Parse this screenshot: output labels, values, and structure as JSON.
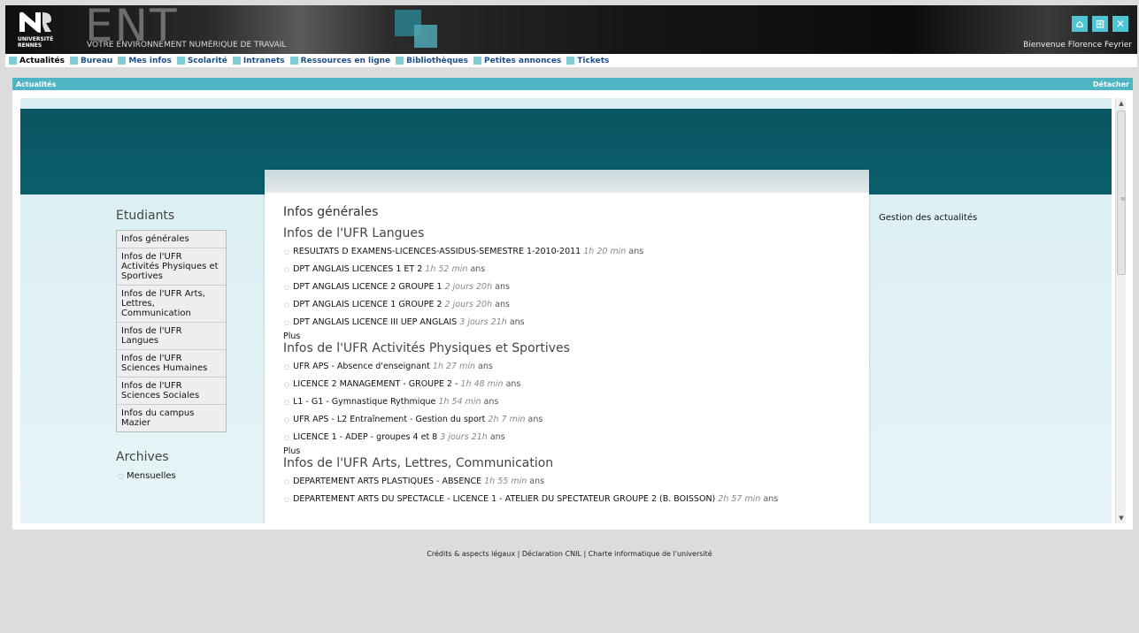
{
  "banner": {
    "logo_line1": "UNIVERSITÉ",
    "logo_line2": "RENNES",
    "ent": "ENT",
    "slogan": "VOTRE ENVIRONNEMENT NUMÉRIQUE DE TRAVAIL",
    "welcome": "Bienvenue Florence Feyrier",
    "icons": [
      "home-icon",
      "sitemap-icon",
      "close-icon"
    ]
  },
  "nav": {
    "items": [
      {
        "label": "Actualités",
        "active": true
      },
      {
        "label": "Bureau"
      },
      {
        "label": "Mes infos"
      },
      {
        "label": "Scolarité"
      },
      {
        "label": "Intranets"
      },
      {
        "label": "Ressources en ligne"
      },
      {
        "label": "Bibliothèques"
      },
      {
        "label": "Petites annonces"
      },
      {
        "label": "Tickets"
      }
    ]
  },
  "portlet": {
    "title": "Actualités",
    "detach": "Détacher"
  },
  "left": {
    "heading": "Etudiants",
    "menu": [
      "Infos générales",
      "Infos de l'UFR Activités Physiques et Sportives",
      "Infos de l'UFR Arts, Lettres, Communication",
      "Infos de l'UFR Langues",
      "Infos de l'UFR Sciences Humaines",
      "Infos de l'UFR Sciences Sociales",
      "Infos du campus Mazier"
    ],
    "archives_heading": "Archives",
    "archives": [
      "Mensuelles"
    ]
  },
  "center": {
    "title": "Infos générales",
    "plus_label": "Plus",
    "sections": [
      {
        "title": "Infos de l'UFR Langues",
        "items": [
          {
            "text": "RESULTATS D EXAMENS-LICENCES-ASSIDUS-SEMESTRE 1-2010-2011",
            "time": "1h 20 min",
            "suffix": "ans"
          },
          {
            "text": "DPT ANGLAIS LICENCES 1 ET 2",
            "time": "1h 52 min",
            "suffix": "ans"
          },
          {
            "text": "DPT ANGLAIS LICENCE 2 GROUPE 1",
            "time": "2 jours 20h",
            "suffix": "ans"
          },
          {
            "text": "DPT ANGLAIS LICENCE 1 GROUPE 2",
            "time": "2 jours 20h",
            "suffix": "ans"
          },
          {
            "text": "DPT ANGLAIS LICENCE III UEP ANGLAIS",
            "time": "3 jours 21h",
            "suffix": "ans"
          }
        ]
      },
      {
        "title": "Infos de l'UFR Activités Physiques et Sportives",
        "items": [
          {
            "text": "UFR APS - Absence d'enseignant",
            "time": "1h 27 min",
            "suffix": "ans"
          },
          {
            "text": "LICENCE 2 MANAGEMENT - GROUPE 2 -",
            "time": "1h 48 min",
            "suffix": "ans"
          },
          {
            "text": "L1 - G1 - Gymnastique Rythmique",
            "time": "1h 54 min",
            "suffix": "ans"
          },
          {
            "text": "UFR APS - L2 Entraînement - Gestion du sport",
            "time": "2h 7 min",
            "suffix": "ans"
          },
          {
            "text": "LICENCE 1 - ADEP - groupes 4 et 8",
            "time": "3 jours 21h",
            "suffix": "ans"
          }
        ]
      },
      {
        "title": "Infos de l'UFR Arts, Lettres, Communication",
        "items": [
          {
            "text": "DEPARTEMENT ARTS PLASTIQUES - ABSENCE",
            "time": "1h 55 min",
            "suffix": "ans"
          },
          {
            "text": "DEPARTEMENT ARTS DU SPECTACLE - LICENCE 1 - ATELIER DU SPECTATEUR GROUPE 2 (B. BOISSON)",
            "time": "2h 57 min",
            "suffix": "ans"
          }
        ]
      }
    ]
  },
  "right": {
    "manage": "Gestion des actualités"
  },
  "footer": {
    "text": "Crédits & aspects légaux | Déclaration CNIL | Charte informatique de l'université"
  },
  "colors": {
    "accent": "#4fb5c4",
    "band": "#0a5562",
    "nav_link": "#1d4f88"
  }
}
